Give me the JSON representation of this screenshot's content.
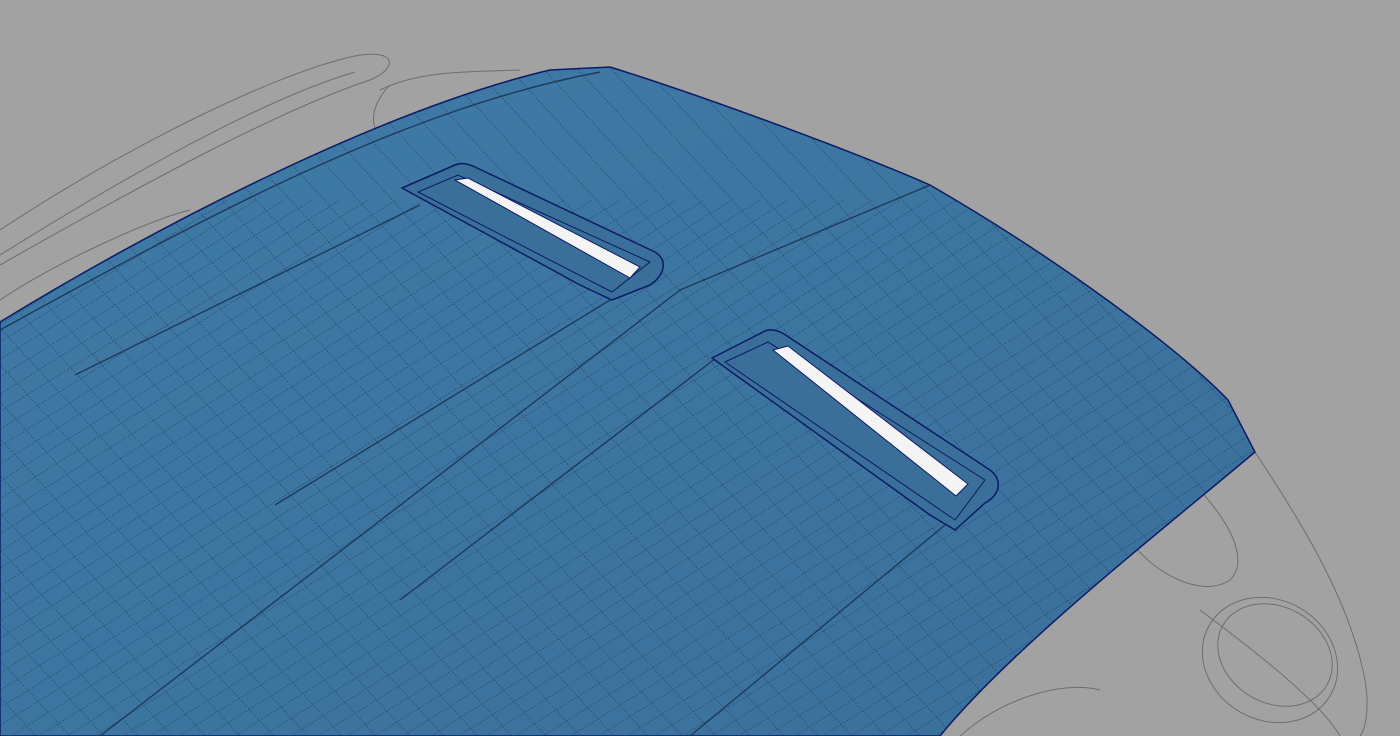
{
  "viewport": {
    "background_color": "#a2a2a2",
    "surface_color": "#3d76a2",
    "surface_dark_color": "#2f5f86",
    "isoparm_color": "#1f3f5e",
    "edge_color": "#0d1a66",
    "vent_opening_color": "#f4f4f4",
    "reference_curve_color": "#6e6e6e"
  }
}
